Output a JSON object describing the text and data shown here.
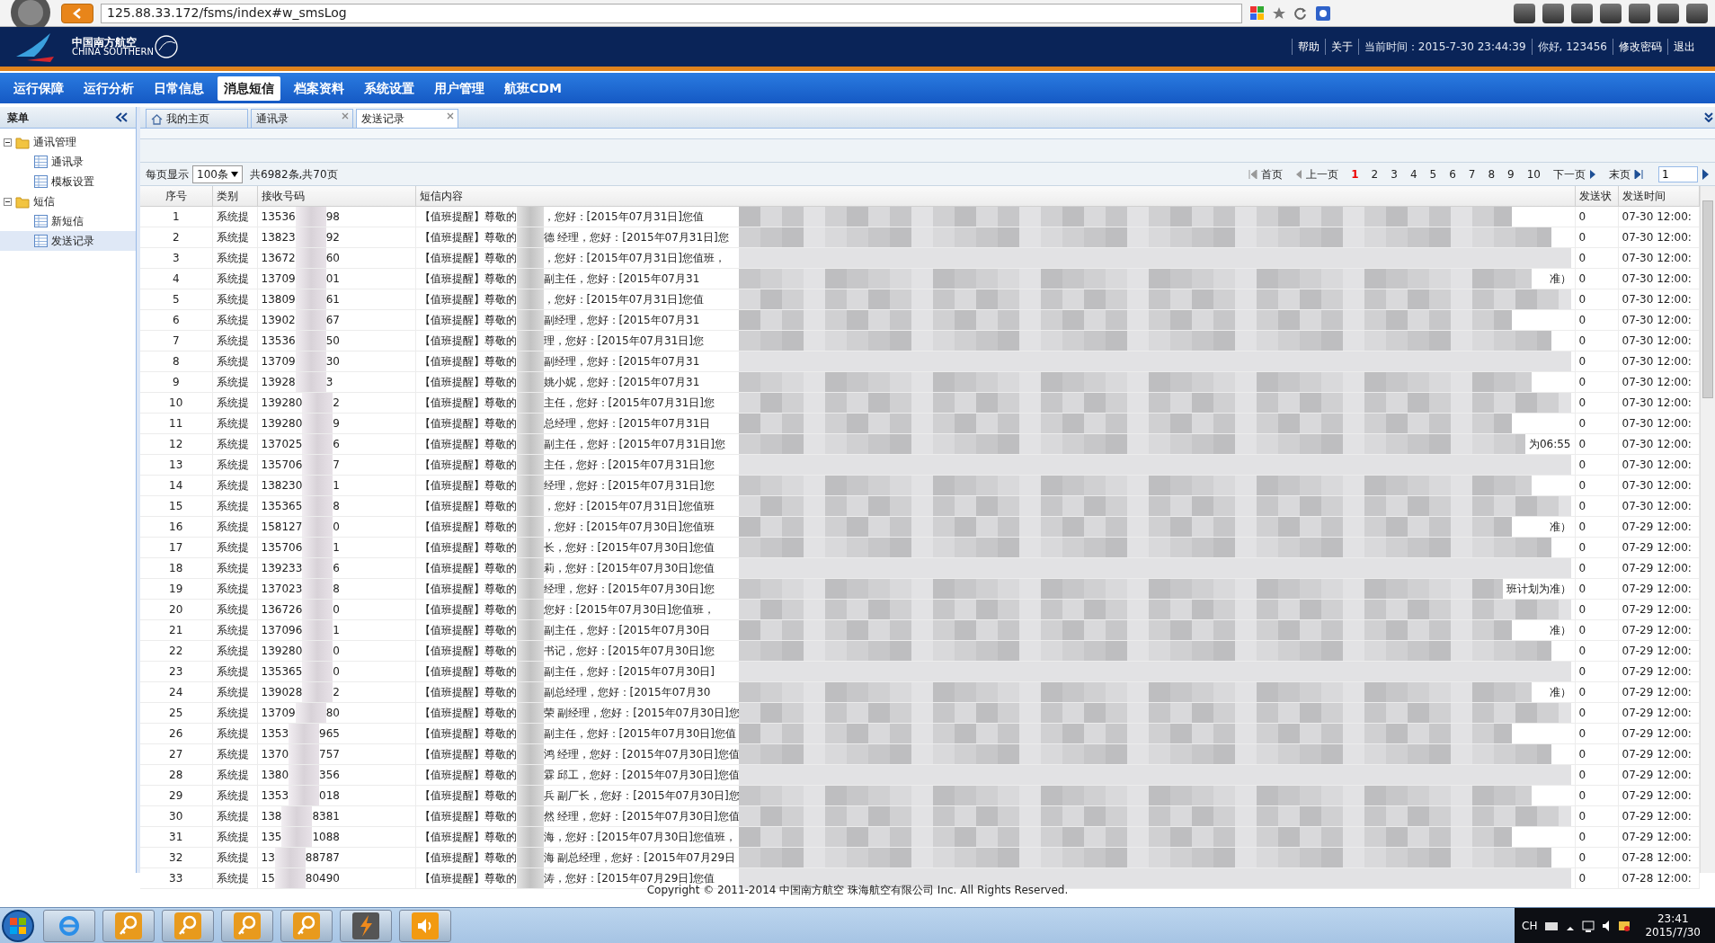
{
  "browser": {
    "address": "125.88.33.172/fsms/index#w_smsLog"
  },
  "header": {
    "logo_cn": "中国南方航空",
    "logo_en": "CHINA SOUTHERN",
    "links": [
      {
        "label": "帮助",
        "kind": "link"
      },
      {
        "label": "关于",
        "kind": "link"
      },
      {
        "label": "当前时间：2015-7-30 23:44:39",
        "kind": "text"
      },
      {
        "label": "你好, 123456",
        "kind": "text"
      },
      {
        "label": "修改密码",
        "kind": "link"
      },
      {
        "label": "退出",
        "kind": "link"
      }
    ]
  },
  "nav": [
    {
      "label": "运行保障",
      "selected": false
    },
    {
      "label": "运行分析",
      "selected": false
    },
    {
      "label": "日常信息",
      "selected": false
    },
    {
      "label": "消息短信",
      "selected": true
    },
    {
      "label": "档案资料",
      "selected": false
    },
    {
      "label": "系统设置",
      "selected": false
    },
    {
      "label": "用户管理",
      "selected": false
    },
    {
      "label": "航班CDM",
      "selected": false
    }
  ],
  "sidebar": {
    "title": "菜单",
    "items": [
      {
        "label": "通讯管理",
        "expanded": true,
        "children": [
          {
            "label": "通讯录",
            "selected": false
          },
          {
            "label": "模板设置",
            "selected": false
          }
        ]
      },
      {
        "label": "短信",
        "expanded": true,
        "children": [
          {
            "label": "新短信",
            "selected": false
          },
          {
            "label": "发送记录",
            "selected": true
          }
        ]
      }
    ]
  },
  "tabs": [
    {
      "label": "我的主页",
      "kind": "home",
      "selected": false
    },
    {
      "label": "通讯录",
      "kind": "closable",
      "selected": false
    },
    {
      "label": "发送记录",
      "kind": "closable",
      "selected": true
    }
  ],
  "pager": {
    "per_page_label": "每页显示",
    "per_page": "100条",
    "total": "共6982条,共70页",
    "first": "首页",
    "prev": "上一页",
    "pages": [
      {
        "label": "1",
        "selected": true
      },
      {
        "label": "2",
        "selected": false
      },
      {
        "label": "3",
        "selected": false
      },
      {
        "label": "4",
        "selected": false
      },
      {
        "label": "5",
        "selected": false
      },
      {
        "label": "6",
        "selected": false
      },
      {
        "label": "7",
        "selected": false
      },
      {
        "label": "8",
        "selected": false
      },
      {
        "label": "9",
        "selected": false
      },
      {
        "label": "10",
        "selected": false
      }
    ],
    "next": "下一页",
    "last": "末页",
    "page_input": "1"
  },
  "table": {
    "columns": [
      "序号",
      "类别",
      "接收号码",
      "短信内容",
      "发送状",
      "发送时间"
    ],
    "rows": [
      {
        "no": "1",
        "type": "系统提",
        "phone_start": "13536",
        "phone_end": "98",
        "prefix": "【值班提醒】尊敬的",
        "text": "，您好：[2015年07月31日]您值",
        "status": "0",
        "time": "07-30 12:00:"
      },
      {
        "no": "2",
        "type": "系统提",
        "phone_start": "13823",
        "phone_end": "92",
        "prefix": "【值班提醒】尊敬的",
        "text": "德 经理，您好：[2015年07月31日]您",
        "status": "0",
        "time": "07-30 12:00:"
      },
      {
        "no": "3",
        "type": "系统提",
        "phone_start": "13672",
        "phone_end": "60",
        "prefix": "【值班提醒】尊敬的",
        "text": "，您好：[2015年07月31日]您值班，",
        "status": "0",
        "time": "07-30 12:00:"
      },
      {
        "no": "4",
        "type": "系统提",
        "phone_start": "13709",
        "phone_end": "01",
        "prefix": "【值班提醒】尊敬的",
        "text": "副主任，您好：[2015年07月31",
        "tail": "准）",
        "status": "0",
        "time": "07-30 12:00:"
      },
      {
        "no": "5",
        "type": "系统提",
        "phone_start": "13809",
        "phone_end": "61",
        "prefix": "【值班提醒】尊敬的",
        "text": "，您好：[2015年07月31日]您值",
        "status": "0",
        "time": "07-30 12:00:"
      },
      {
        "no": "6",
        "type": "系统提",
        "phone_start": "13902",
        "phone_end": "67",
        "prefix": "【值班提醒】尊敬的",
        "text": "副经理，您好：[2015年07月31",
        "status": "0",
        "time": "07-30 12:00:"
      },
      {
        "no": "7",
        "type": "系统提",
        "phone_start": "13536",
        "phone_end": "50",
        "prefix": "【值班提醒】尊敬的",
        "text": "理，您好：[2015年07月31日]您",
        "status": "0",
        "time": "07-30 12:00:"
      },
      {
        "no": "8",
        "type": "系统提",
        "phone_start": "13709",
        "phone_end": "30",
        "prefix": "【值班提醒】尊敬的",
        "text": "副经理，您好：[2015年07月31",
        "status": "0",
        "time": "07-30 12:00:"
      },
      {
        "no": "9",
        "type": "系统提",
        "phone_start": "13928",
        "phone_end": "3",
        "prefix": "【值班提醒】尊敬的",
        "text": "姚小妮，您好：[2015年07月31",
        "status": "0",
        "time": "07-30 12:00:"
      },
      {
        "no": "10",
        "type": "系统提",
        "phone_start": "139280",
        "phone_end": "2",
        "prefix": "【值班提醒】尊敬的",
        "text": "主任，您好：[2015年07月31日]您",
        "status": "0",
        "time": "07-30 12:00:"
      },
      {
        "no": "11",
        "type": "系统提",
        "phone_start": "139280",
        "phone_end": "9",
        "prefix": "【值班提醒】尊敬的",
        "text": "总经理，您好：[2015年07月31日",
        "status": "0",
        "time": "07-30 12:00:"
      },
      {
        "no": "12",
        "type": "系统提",
        "phone_start": "137025",
        "phone_end": "6",
        "prefix": "【值班提醒】尊敬的",
        "text": "副主任，您好：[2015年07月31日]您",
        "tail": "为06:55",
        "status": "0",
        "time": "07-30 12:00:"
      },
      {
        "no": "13",
        "type": "系统提",
        "phone_start": "135706",
        "phone_end": "7",
        "prefix": "【值班提醒】尊敬的",
        "text": "主任，您好：[2015年07月31日]您",
        "status": "0",
        "time": "07-30 12:00:"
      },
      {
        "no": "14",
        "type": "系统提",
        "phone_start": "138230",
        "phone_end": "1",
        "prefix": "【值班提醒】尊敬的",
        "text": "经理，您好：[2015年07月31日]您",
        "status": "0",
        "time": "07-30 12:00:"
      },
      {
        "no": "15",
        "type": "系统提",
        "phone_start": "135365",
        "phone_end": "8",
        "prefix": "【值班提醒】尊敬的",
        "text": "，您好：[2015年07月31日]您值班",
        "status": "0",
        "time": "07-30 12:00:"
      },
      {
        "no": "16",
        "type": "系统提",
        "phone_start": "158127",
        "phone_end": "0",
        "prefix": "【值班提醒】尊敬的",
        "text": "，您好：[2015年07月30日]您值班",
        "tail": "准）",
        "status": "0",
        "time": "07-29 12:00:"
      },
      {
        "no": "17",
        "type": "系统提",
        "phone_start": "135706",
        "phone_end": "1",
        "prefix": "【值班提醒】尊敬的",
        "text": "长，您好：[2015年07月30日]您值",
        "status": "0",
        "time": "07-29 12:00:"
      },
      {
        "no": "18",
        "type": "系统提",
        "phone_start": "139233",
        "phone_end": "6",
        "prefix": "【值班提醒】尊敬的",
        "text": "莉，您好：[2015年07月30日]您值",
        "status": "0",
        "time": "07-29 12:00:"
      },
      {
        "no": "19",
        "type": "系统提",
        "phone_start": "137023",
        "phone_end": "8",
        "prefix": "【值班提醒】尊敬的",
        "text": "经理，您好：[2015年07月30日]您",
        "tail": "班计划为准）",
        "status": "0",
        "time": "07-29 12:00:"
      },
      {
        "no": "20",
        "type": "系统提",
        "phone_start": "136726",
        "phone_end": "0",
        "prefix": "【值班提醒】尊敬的",
        "text": "您好：[2015年07月30日]您值班，",
        "status": "0",
        "time": "07-29 12:00:"
      },
      {
        "no": "21",
        "type": "系统提",
        "phone_start": "137096",
        "phone_end": "1",
        "prefix": "【值班提醒】尊敬的",
        "text": "副主任，您好：[2015年07月30日",
        "tail": "准）",
        "status": "0",
        "time": "07-29 12:00:"
      },
      {
        "no": "22",
        "type": "系统提",
        "phone_start": "139280",
        "phone_end": "0",
        "prefix": "【值班提醒】尊敬的",
        "text": "书记，您好：[2015年07月30日]您",
        "status": "0",
        "time": "07-29 12:00:"
      },
      {
        "no": "23",
        "type": "系统提",
        "phone_start": "135365",
        "phone_end": "0",
        "prefix": "【值班提醒】尊敬的",
        "text": "副主任，您好：[2015年07月30日]",
        "status": "0",
        "time": "07-29 12:00:"
      },
      {
        "no": "24",
        "type": "系统提",
        "phone_start": "139028",
        "phone_end": "2",
        "prefix": "【值班提醒】尊敬的",
        "text": "副总经理，您好：[2015年07月30",
        "tail": "准）",
        "status": "0",
        "time": "07-29 12:00:"
      },
      {
        "no": "25",
        "type": "系统提",
        "phone_start": "13709",
        "phone_end": "80",
        "prefix": "【值班提醒】尊敬的",
        "text": "荣 副经理，您好：[2015年07月30日]您",
        "status": "0",
        "time": "07-29 12:00:"
      },
      {
        "no": "26",
        "type": "系统提",
        "phone_start": "1353",
        "phone_end": "965",
        "prefix": "【值班提醒】尊敬的",
        "text": "副主任，您好：[2015年07月30日]您值",
        "status": "0",
        "time": "07-29 12:00:"
      },
      {
        "no": "27",
        "type": "系统提",
        "phone_start": "1370",
        "phone_end": "757",
        "prefix": "【值班提醒】尊敬的",
        "text": "鸿 经理，您好：[2015年07月30日]您值",
        "status": "0",
        "time": "07-29 12:00:"
      },
      {
        "no": "28",
        "type": "系统提",
        "phone_start": "1380",
        "phone_end": "356",
        "prefix": "【值班提醒】尊敬的",
        "text": "霖 邱工，您好：[2015年07月30日]您值",
        "status": "0",
        "time": "07-29 12:00:"
      },
      {
        "no": "29",
        "type": "系统提",
        "phone_start": "1353",
        "phone_end": "018",
        "prefix": "【值班提醒】尊敬的",
        "text": "兵 副厂长，您好：[2015年07月30日]您",
        "status": "0",
        "time": "07-29 12:00:"
      },
      {
        "no": "30",
        "type": "系统提",
        "phone_start": "138",
        "phone_end": "8381",
        "prefix": "【值班提醒】尊敬的",
        "text": "然 经理，您好：[2015年07月30日]您值",
        "status": "0",
        "time": "07-29 12:00:"
      },
      {
        "no": "31",
        "type": "系统提",
        "phone_start": "135",
        "phone_end": "1088",
        "prefix": "【值班提醒】尊敬的",
        "text": "海，您好：[2015年07月30日]您值班，",
        "status": "0",
        "time": "07-29 12:00:"
      },
      {
        "no": "32",
        "type": "系统提",
        "phone_start": "13",
        "phone_end": "88787",
        "prefix": "【值班提醒】尊敬的",
        "text": "海 副总经理，您好：[2015年07月29日",
        "status": "0",
        "time": "07-28 12:00:"
      },
      {
        "no": "33",
        "type": "系统提",
        "phone_start": "15",
        "phone_end": "80490",
        "prefix": "【值班提醒】尊敬的",
        "text": "涛，您好：[2015年07月29日]您值",
        "status": "0",
        "time": "07-28 12:00:"
      }
    ]
  },
  "footer": "Copyright © 2011-2014 中国南方航空 珠海航空有限公司 Inc. All Rights Reserved.",
  "taskbar": {
    "lang": "CH",
    "time": "23:41",
    "date": "2015/7/30"
  }
}
